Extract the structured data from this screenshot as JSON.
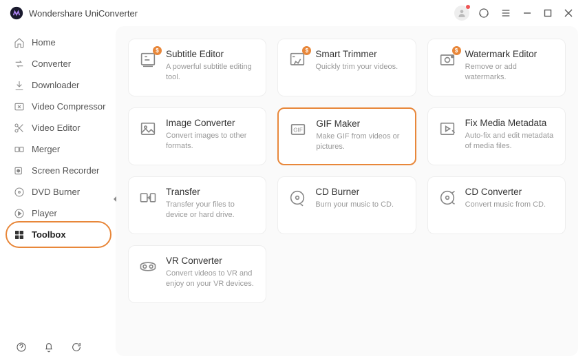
{
  "app_title": "Wondershare UniConverter",
  "sidebar": {
    "items": [
      {
        "label": "Home"
      },
      {
        "label": "Converter"
      },
      {
        "label": "Downloader"
      },
      {
        "label": "Video Compressor"
      },
      {
        "label": "Video Editor"
      },
      {
        "label": "Merger"
      },
      {
        "label": "Screen Recorder"
      },
      {
        "label": "DVD Burner"
      },
      {
        "label": "Player"
      },
      {
        "label": "Toolbox"
      }
    ]
  },
  "tools": [
    {
      "title": "Subtitle Editor",
      "desc": "A powerful subtitle editing tool.",
      "badge": "$"
    },
    {
      "title": "Smart Trimmer",
      "desc": "Quickly trim your videos.",
      "badge": "$"
    },
    {
      "title": "Watermark Editor",
      "desc": "Remove or add watermarks.",
      "badge": "$"
    },
    {
      "title": "Image Converter",
      "desc": "Convert images to other formats."
    },
    {
      "title": "GIF Maker",
      "desc": "Make GIF from videos or pictures."
    },
    {
      "title": "Fix Media Metadata",
      "desc": "Auto-fix and edit metadata of media files."
    },
    {
      "title": "Transfer",
      "desc": "Transfer your files to device or hard drive."
    },
    {
      "title": "CD Burner",
      "desc": "Burn your music to CD."
    },
    {
      "title": "CD Converter",
      "desc": "Convert music from CD."
    },
    {
      "title": "VR Converter",
      "desc": "Convert videos to VR and enjoy on your VR devices."
    }
  ]
}
